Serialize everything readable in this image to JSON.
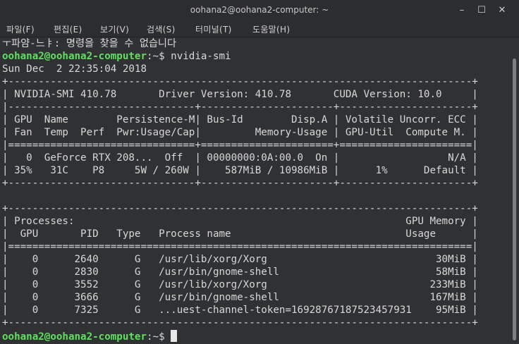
{
  "window": {
    "title": "oohana2@oohana2-computer: ~",
    "minimize_glyph": "–",
    "maximize_glyph": "☐",
    "close_glyph": "✕"
  },
  "menu": [
    "파일(F)",
    "편집(E)",
    "보기(V)",
    "검색(S)",
    "터미널(T)",
    "도움말(H)"
  ],
  "terminal": {
    "header_line": "ㅜ파얌-느ㅑ: 명령을 찾을 수 없습니다",
    "prompt_user": "oohana2@oohana2-computer",
    "prompt_path": ":~$",
    "command": " nvidia-smi",
    "output": [
      "Sun Dec  2 22:35:04 2018",
      "+-----------------------------------------------------------------------------+",
      "| NVIDIA-SMI 410.78       Driver Version: 410.78       CUDA Version: 10.0     |",
      "|-------------------------------+----------------------+----------------------+",
      "| GPU  Name        Persistence-M| Bus-Id        Disp.A | Volatile Uncorr. ECC |",
      "| Fan  Temp  Perf  Pwr:Usage/Cap|         Memory-Usage | GPU-Util  Compute M. |",
      "|===============================+======================+======================|",
      "|   0  GeForce RTX 208...  Off  | 00000000:0A:00.0  On |                  N/A |",
      "| 35%   31C    P8     5W / 260W |    587MiB / 10986MiB |      1%      Default |",
      "+-------------------------------+----------------------+----------------------+",
      "                                                                               ",
      "+-----------------------------------------------------------------------------+",
      "| Processes:                                                       GPU Memory |",
      "|  GPU       PID   Type   Process name                             Usage      |",
      "|=============================================================================|",
      "|    0      2640      G   /usr/lib/xorg/Xorg                            30MiB |",
      "|    0      2830      G   /usr/bin/gnome-shell                          58MiB |",
      "|    0      3552      G   /usr/lib/xorg/Xorg                           233MiB |",
      "|    0      3666      G   /usr/bin/gnome-shell                         167MiB |",
      "|    0      7325      G   ...uest-channel-token=16928767187523457931    95MiB |",
      "+-----------------------------------------------------------------------------+"
    ],
    "final_prompt_path": ":~$ "
  }
}
